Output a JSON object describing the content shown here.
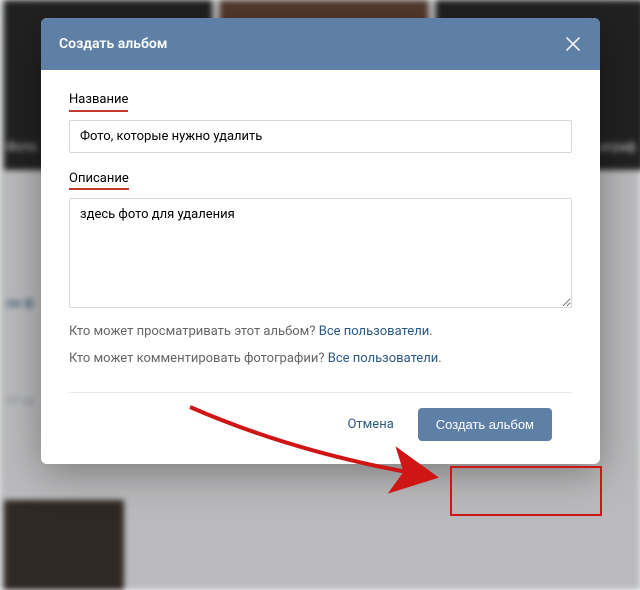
{
  "background": {
    "left_label": "Фото",
    "section_label": "ои ф",
    "date_fragment": "17 го",
    "right_fragment": "ограф"
  },
  "modal": {
    "title": "Создать альбом",
    "fields": {
      "name_label": "Название",
      "name_value": "Фото, которые нужно удалить",
      "desc_label": "Описание",
      "desc_value": "здесь фото для удаления"
    },
    "privacy": {
      "view_question": "Кто может просматривать этот альбом?",
      "view_value": "Все пользователи",
      "comment_question": "Кто может комментировать фотографии?",
      "comment_value": "Все пользователи",
      "suffix": "."
    },
    "footer": {
      "cancel": "Отмена",
      "submit": "Создать альбом"
    }
  }
}
